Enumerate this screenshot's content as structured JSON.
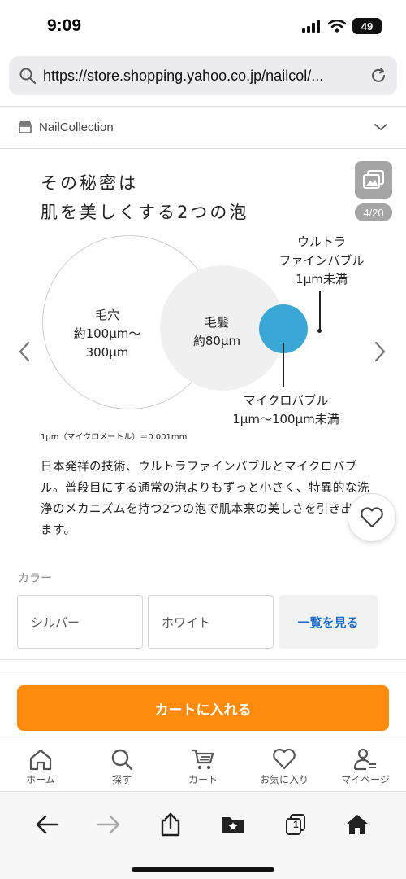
{
  "status": {
    "time": "9:09",
    "battery": "49"
  },
  "browser": {
    "url": "https://store.shopping.yahoo.co.jp/nailcol/..."
  },
  "store": {
    "name": "NailCollection"
  },
  "gallery": {
    "counter": "4/20",
    "headline_line1": "その秘密は",
    "headline_line2": "肌を美しくする2つの泡",
    "pore_label": "毛穴",
    "pore_size_line1": "約100μm〜",
    "pore_size_line2": "300μm",
    "hair_label": "毛髪",
    "hair_size": "約80μm",
    "ultrafine_line1": "ウルトラ",
    "ultrafine_line2": "ファインバブル",
    "ultrafine_line3": "1μm未満",
    "micro_line1": "マイクロバブル",
    "micro_line2": "1μm〜100μm未満",
    "footnote": "1μm（マイクロメートル）＝0.001mm",
    "body_text": "日本発祥の技術、ウルトラファインバブルとマイクロバブル。普段目にする通常の泡よりもずっと小さく、特異的な洗浄のメカニズムを持つ2つの泡で肌本来の美しさを引き出します。",
    "bubble_color": "#3aa8d6"
  },
  "color_section": {
    "label": "カラー",
    "options": [
      "シルバー",
      "ホワイト"
    ],
    "view_all": "一覧を見る"
  },
  "cart_button": "カートに入れる",
  "cart_color": "#ff8a0d",
  "tabs": [
    {
      "label": "ホーム",
      "icon": "home-icon"
    },
    {
      "label": "探す",
      "icon": "search-icon"
    },
    {
      "label": "カート",
      "icon": "cart-icon"
    },
    {
      "label": "お気に入り",
      "icon": "heart-icon"
    },
    {
      "label": "マイページ",
      "icon": "user-icon"
    }
  ],
  "toolbar": {
    "tab_count": "1"
  }
}
